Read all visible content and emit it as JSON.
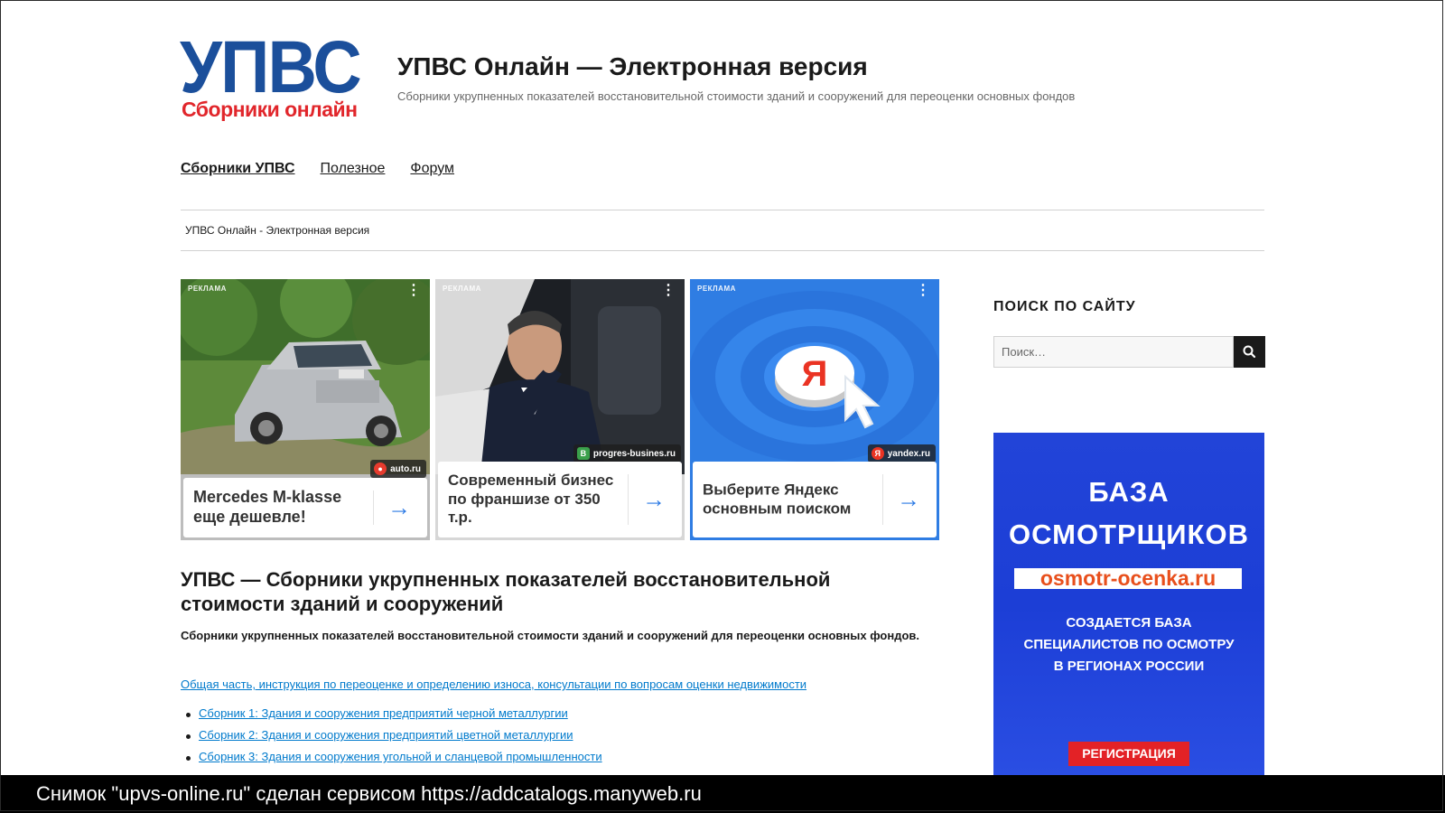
{
  "header": {
    "logo_main": "УПВС",
    "logo_sub": "Сборники онлайн",
    "site_title": "УПВС Онлайн — Электронная версия",
    "site_description": "Сборники укрупненных показателей восстановительной стоимости зданий и сооружений для переоценки основных фондов"
  },
  "nav": {
    "items": [
      {
        "label": "Сборники УПВС",
        "active": true
      },
      {
        "label": "Полезное",
        "active": false
      },
      {
        "label": "Форум",
        "active": false
      }
    ]
  },
  "breadcrumb": {
    "text": "УПВС Онлайн - Электронная версия"
  },
  "ads": [
    {
      "label": "РЕКЛАМА",
      "domain": "auto.ru",
      "text": "Mercedes M-klasse еще дешевле!"
    },
    {
      "label": "РЕКЛАМА",
      "domain": "progres-busines.ru",
      "text": "Современный бизнес по франшизе от 350 т.р."
    },
    {
      "label": "РЕКЛАМА",
      "domain": "yandex.ru",
      "text": "Выберите Яндекс основным поиском"
    }
  ],
  "main": {
    "title": "УПВС — Сборники укрупненных показателей восстановительной стоимости зданий и сооружений",
    "intro": "Сборники укрупненных показателей восстановительной стоимости зданий и сооружений для переоценки основных фондов.",
    "general_link": "Общая часть, инструкция по переоценке и определению износа, консультации по вопросам оценки недвижимости",
    "collections": [
      "Сборник 1: Здания и сооружения предприятий черной металлургии",
      "Сборник 2: Здания и сооружения предприятий цветной металлургии",
      "Сборник 3: Здания и сооружения угольной и сланцевой промышленности"
    ]
  },
  "sidebar": {
    "search_heading": "ПОИСК ПО САЙТУ",
    "search_placeholder": "Поиск…",
    "banner": {
      "title_line1": "БАЗА",
      "title_line2": "ОСМОТРЩИКОВ",
      "url": "osmotr-ocenka.ru",
      "sub_line1": "СОЗДАЕТСЯ БАЗА",
      "sub_line2": "СПЕЦИАЛИСТОВ ПО ОСМОТРУ",
      "sub_line3": "В РЕГИОНАХ РОССИИ",
      "button": "РЕГИСТРАЦИЯ"
    }
  },
  "screenshot_caption": "Снимок \"upvs-online.ru\" сделан сервисом https://addcatalogs.manyweb.ru",
  "colors": {
    "logo_blue": "#1b4f9b",
    "logo_red": "#e1262b",
    "link": "#007acc",
    "ad_arrow": "#2e7be5",
    "banner_blue": "#1c3ed6",
    "banner_button": "#e32226"
  }
}
